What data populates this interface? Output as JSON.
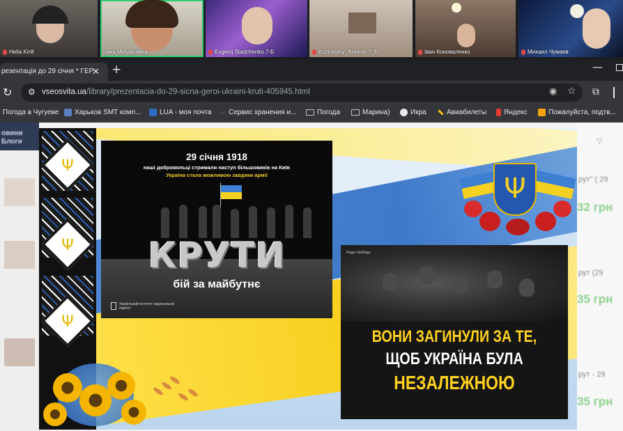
{
  "call": {
    "participants": [
      {
        "name": "Helia Kirill",
        "active": false
      },
      {
        "name": "рина Михайлівна",
        "active": true
      },
      {
        "name": "Evgenij Stadchenko 7-Б",
        "active": false
      },
      {
        "name": "Kozlovskiy_Arseniy 7_Б",
        "active": false
      },
      {
        "name": "Іван Коноваленко",
        "active": false
      },
      {
        "name": "Михаил Чумаев",
        "active": false
      }
    ]
  },
  "browser": {
    "tab_title": "резентація до 29 січня * ГЕР",
    "tab_close": "✕",
    "new_tab": "+",
    "minimize": "—",
    "url_domain": "vseosvita.ua",
    "url_path": "/library/prezentacia-do-29-sicna-geroi-ukraini-kruti-405945.html",
    "bookmarks": [
      {
        "label": "Погода в Чугуеве",
        "icon": "none"
      },
      {
        "label": "Харьков SMT комп...",
        "icon": "smt-icon"
      },
      {
        "label": "LUA - моя почта",
        "icon": "trident-icon"
      },
      {
        "label": "Сервис хранения и...",
        "icon": "cloud-icon"
      },
      {
        "label": "Погода",
        "icon": "folder-icon"
      },
      {
        "label": "Марина)",
        "icon": "folder-icon"
      },
      {
        "label": "Икра",
        "icon": "globe-icon"
      },
      {
        "label": "Авиабилеты",
        "icon": "plane-icon"
      },
      {
        "label": "Яндекс",
        "icon": "yandex-icon"
      },
      {
        "label": "Пожалуйста, подтв...",
        "icon": "mail-icon"
      }
    ]
  },
  "page": {
    "left_blur_1": "овини",
    "left_blur_2": "Блоги",
    "right_items": [
      {
        "label": "рут\" ( 29",
        "price": "32 грн"
      },
      {
        "label": "рут (29",
        "price": "35 грн"
      },
      {
        "label": "рут - 29",
        "price": "35 грн"
      }
    ]
  },
  "slide": {
    "card1": {
      "date": "29 січня 1918",
      "line1": "наші добровольці стримали наступ більшовиків на Київ",
      "line2": "Україна стала можливою завдяки армії",
      "title": "КРУТИ",
      "subtitle": "бій за майбутнє",
      "institute": "Український інститут національної пам'яті"
    },
    "card2": {
      "badge": "Радіо Свобода",
      "line1": "ВОНИ ЗАГИНУЛИ ЗА ТЕ,",
      "line2": "ЩОБ УКРАЇНА БУЛА",
      "line3": "НЕЗАЛЕЖНОЮ"
    },
    "colors": {
      "blue": "#2d6cc4",
      "yellow": "#f7cf1e"
    }
  }
}
